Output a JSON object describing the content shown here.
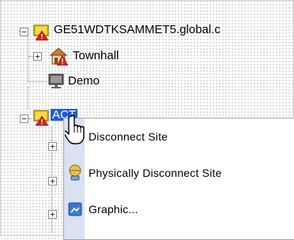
{
  "tree": {
    "nodes": [
      {
        "label": "GE51WDTKSAMMET5.global.c",
        "icon": "computer-alarm-icon",
        "expander": "−"
      },
      {
        "label": "Townhall",
        "icon": "house-alarm-icon",
        "expander": "+"
      },
      {
        "label": "Demo",
        "icon": "computer-icon",
        "expander": ""
      },
      {
        "label": "ACT",
        "icon": "computer-alarm-icon",
        "expander": "−"
      }
    ],
    "hidden_child_expanders": [
      "+",
      "+",
      "+"
    ]
  },
  "context_menu": {
    "items": [
      {
        "label": "Disconnect Site",
        "icon": "disconnect-icon"
      },
      {
        "label": "Physically Disconnect Site",
        "icon": "physically-disconnect-icon"
      },
      {
        "label": "Graphic...",
        "icon": "graphic-icon"
      }
    ]
  },
  "colors": {
    "selection": "#1f5fd6",
    "menu_gutter": "#d9e2f1",
    "alarm_red": "#d41f1f",
    "alarm_yellow": "#f0c800"
  }
}
